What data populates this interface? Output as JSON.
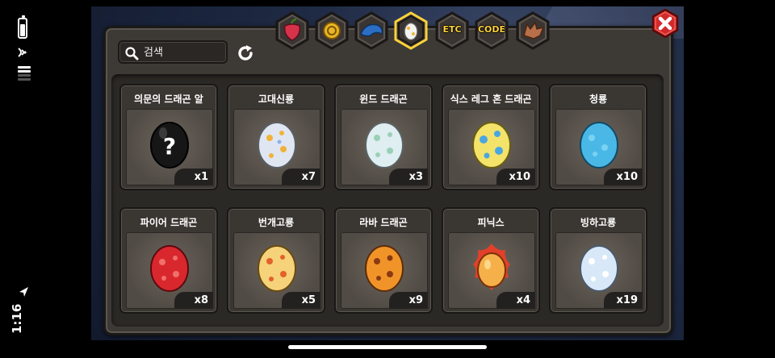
{
  "status": {
    "time": "1:16"
  },
  "search": {
    "placeholder": "검색"
  },
  "tabs": [
    {
      "name": "fruit",
      "label": ""
    },
    {
      "name": "coin",
      "label": ""
    },
    {
      "name": "dragon-item",
      "label": ""
    },
    {
      "name": "egg",
      "label": "",
      "active": true
    },
    {
      "name": "etc",
      "label": "ETC"
    },
    {
      "name": "code",
      "label": "CODE"
    },
    {
      "name": "dragon",
      "label": ""
    }
  ],
  "items": [
    {
      "name": "의문의 드래곤 알",
      "qty": "x1",
      "egg": "mystery"
    },
    {
      "name": "고대신룡",
      "qty": "x7",
      "egg": "ancient"
    },
    {
      "name": "윈드 드래곤",
      "qty": "x3",
      "egg": "wind"
    },
    {
      "name": "식스 레그 혼 드래곤",
      "qty": "x10",
      "egg": "sixleg"
    },
    {
      "name": "청룡",
      "qty": "x10",
      "egg": "blue"
    },
    {
      "name": "파이어 드래곤",
      "qty": "x8",
      "egg": "fire"
    },
    {
      "name": "번개고룡",
      "qty": "x5",
      "egg": "thunder"
    },
    {
      "name": "라바 드래곤",
      "qty": "x9",
      "egg": "lava"
    },
    {
      "name": "피닉스",
      "qty": "x4",
      "egg": "phoenix"
    },
    {
      "name": "빙하고룡",
      "qty": "x19",
      "egg": "glacier"
    }
  ],
  "colors": {
    "panel": "#3d3a35",
    "tab_ring": "#5a5550",
    "tab_active_ring": "#ffd23a",
    "close_red": "#d22a2a"
  }
}
